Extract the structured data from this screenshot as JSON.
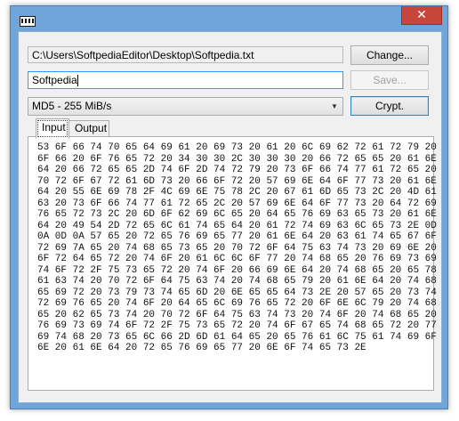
{
  "window": {
    "close_glyph": "✕"
  },
  "file": {
    "path": "C:\\Users\\SoftpediaEditor\\Desktop\\Softpedia.txt",
    "change_label": "Change..."
  },
  "password": {
    "value": "Softpedia",
    "save_label": "Save..."
  },
  "algorithm": {
    "selected": "MD5 - 255 MiB/s",
    "crypt_label": "Crypt."
  },
  "tabs": {
    "input_label": "Input",
    "output_label": "Output"
  },
  "hex_lines": [
    "53 6F 66 74 70 65 64 69 61 20 69 73 20 61 20 6C 69 62 72 61 72 79 20",
    "6F 66 20 6F 76 65 72 20 34 30 30 2C 30 30 30 20 66 72 65 65 20 61 6E",
    "64 20 66 72 65 65 2D 74 6F 2D 74 72 79 20 73 6F 66 74 77 61 72 65 20",
    "70 72 6F 67 72 61 6D 73 20 66 6F 72 20 57 69 6E 64 6F 77 73 20 61 6E",
    "64 20 55 6E 69 78 2F 4C 69 6E 75 78 2C 20 67 61 6D 65 73 2C 20 4D 61",
    "63 20 73 6F 66 74 77 61 72 65 2C 20 57 69 6E 64 6F 77 73 20 64 72 69",
    "76 65 72 73 2C 20 6D 6F 62 69 6C 65 20 64 65 76 69 63 65 73 20 61 6E",
    "64 20 49 54 2D 72 65 6C 61 74 65 64 20 61 72 74 69 63 6C 65 73 2E 0D",
    "0A 0D 0A 57 65 20 72 65 76 69 65 77 20 61 6E 64 20 63 61 74 65 67 6F",
    "72 69 7A 65 20 74 68 65 73 65 20 70 72 6F 64 75 63 74 73 20 69 6E 20",
    "6F 72 64 65 72 20 74 6F 20 61 6C 6C 6F 77 20 74 68 65 20 76 69 73 69",
    "74 6F 72 2F 75 73 65 72 20 74 6F 20 66 69 6E 64 20 74 68 65 20 65 78",
    "61 63 74 20 70 72 6F 64 75 63 74 20 74 68 65 79 20 61 6E 64 20 74 68",
    "65 69 72 20 73 79 73 74 65 6D 20 6E 65 65 64 73 2E 20 57 65 20 73 74",
    "72 69 76 65 20 74 6F 20 64 65 6C 69 76 65 72 20 6F 6E 6C 79 20 74 68",
    "65 20 62 65 73 74 20 70 72 6F 64 75 63 74 73 20 74 6F 20 74 68 65 20",
    "76 69 73 69 74 6F 72 2F 75 73 65 72 20 74 6F 67 65 74 68 65 72 20 77",
    "69 74 68 20 73 65 6C 66 2D 6D 61 64 65 20 65 76 61 6C 75 61 74 69 6F",
    "6E 20 61 6E 64 20 72 65 76 69 65 77 20 6E 6F 74 65 73 2E"
  ]
}
